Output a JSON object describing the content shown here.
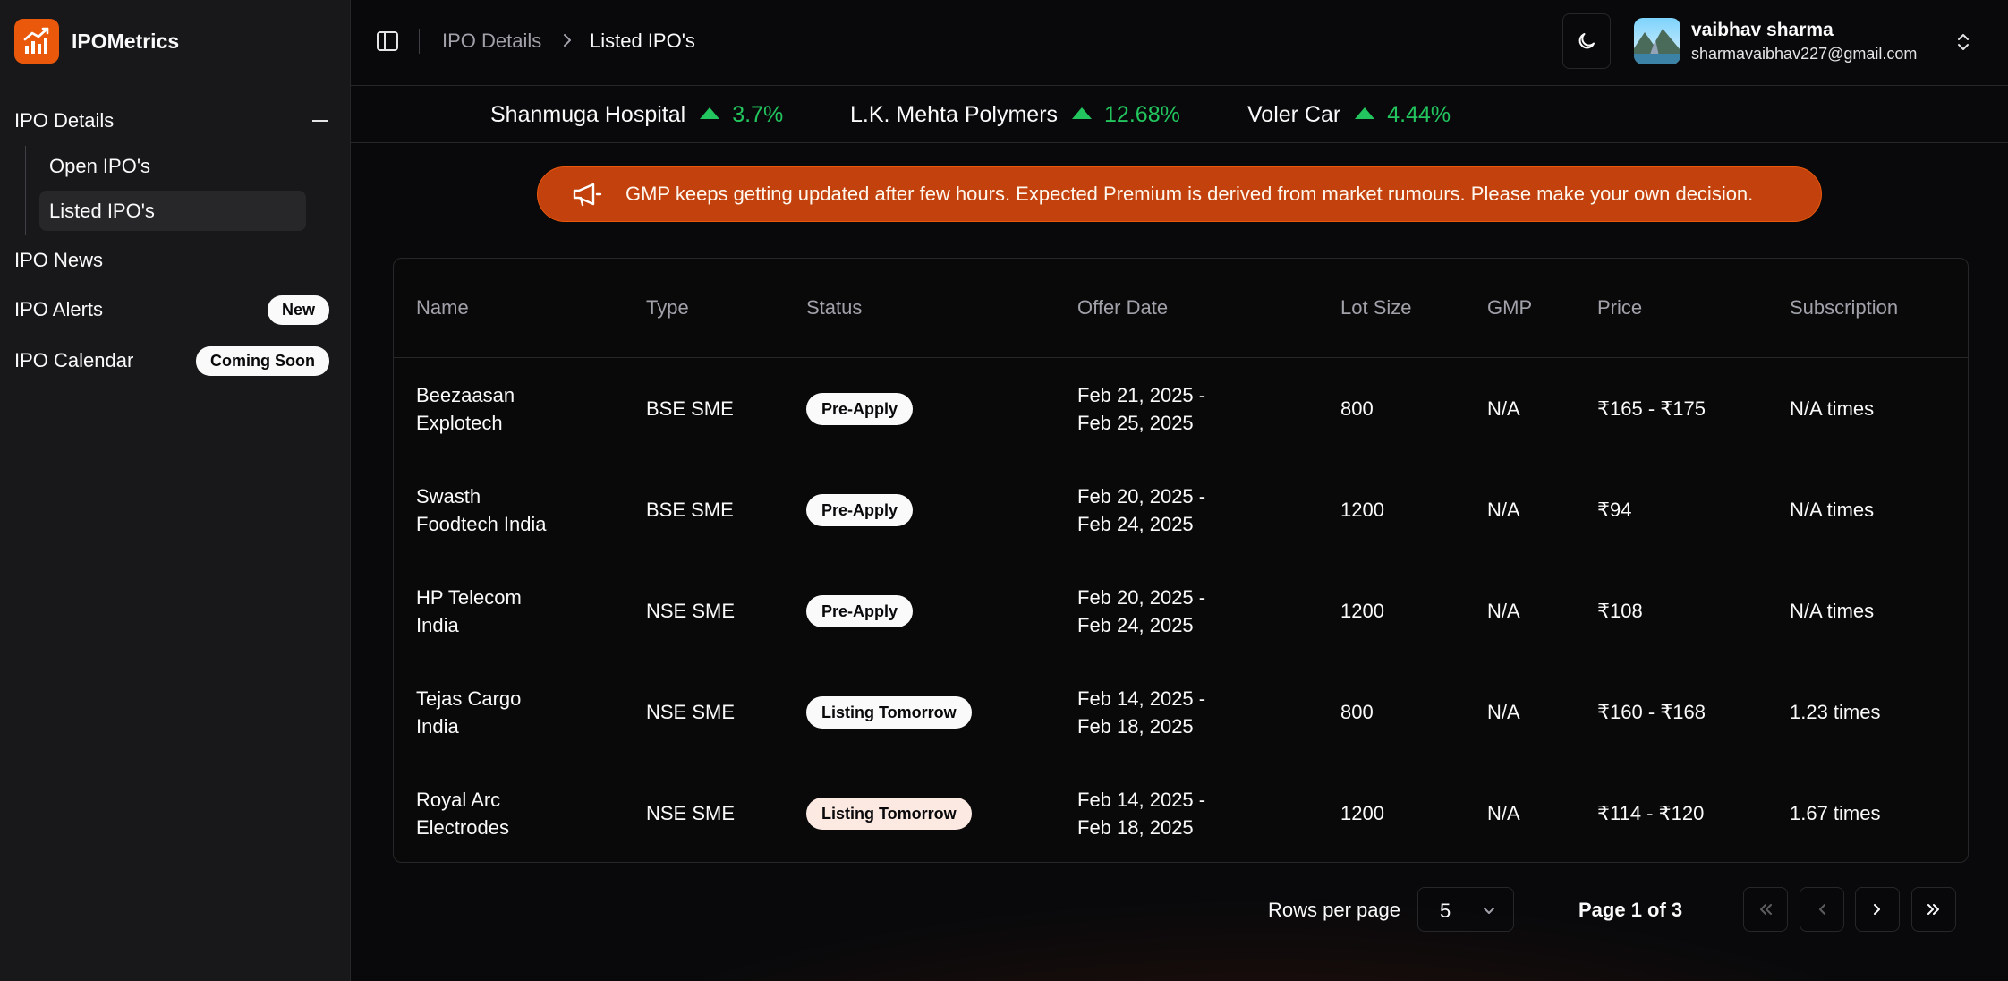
{
  "app": {
    "name": "IPOMetrics"
  },
  "sidebar": {
    "group_label": "IPO Details",
    "sub_items": [
      {
        "label": "Open IPO's"
      },
      {
        "label": "Listed IPO's"
      }
    ],
    "items": [
      {
        "label": "IPO News"
      },
      {
        "label": "IPO Alerts",
        "badge": "New"
      },
      {
        "label": "IPO Calendar",
        "badge": "Coming Soon"
      }
    ]
  },
  "header": {
    "breadcrumb": [
      "IPO Details",
      "Listed IPO's"
    ],
    "user": {
      "name": "vaibhav sharma",
      "email": "sharmavaibhav227@gmail.com"
    }
  },
  "ticker": [
    {
      "name": "Shanmuga Hospital",
      "change": "3.7%"
    },
    {
      "name": "L.K. Mehta Polymers",
      "change": "12.68%"
    },
    {
      "name": "Voler Car",
      "change": "4.44%"
    }
  ],
  "notice": {
    "text": "GMP keeps getting updated after few hours. Expected Premium is derived from market rumours. Please make your own decision."
  },
  "table": {
    "columns": [
      "Name",
      "Type",
      "Status",
      "Offer Date",
      "Lot Size",
      "GMP",
      "Price",
      "Subscription"
    ],
    "rows": [
      {
        "name_line1": "Beezaasan",
        "name_line2": "Explotech",
        "type": "BSE SME",
        "status": "Pre-Apply",
        "date_line1": "Feb 21, 2025 -",
        "date_line2": "Feb 25, 2025",
        "lot": "800",
        "gmp": "N/A",
        "price": "₹165 - ₹175",
        "subscription": "N/A times"
      },
      {
        "name_line1": "Swasth",
        "name_line2": "Foodtech India",
        "type": "BSE SME",
        "status": "Pre-Apply",
        "date_line1": "Feb 20, 2025 -",
        "date_line2": "Feb 24, 2025",
        "lot": "1200",
        "gmp": "N/A",
        "price": "₹94",
        "subscription": "N/A times"
      },
      {
        "name_line1": "HP Telecom",
        "name_line2": "India",
        "type": "NSE SME",
        "status": "Pre-Apply",
        "date_line1": "Feb 20, 2025 -",
        "date_line2": "Feb 24, 2025",
        "lot": "1200",
        "gmp": "N/A",
        "price": "₹108",
        "subscription": "N/A times"
      },
      {
        "name_line1": "Tejas Cargo",
        "name_line2": "India",
        "type": "NSE SME",
        "status": "Listing Tomorrow",
        "date_line1": "Feb 14, 2025 -",
        "date_line2": "Feb 18, 2025",
        "lot": "800",
        "gmp": "N/A",
        "price": "₹160 - ₹168",
        "subscription": "1.23 times"
      },
      {
        "name_line1": "Royal Arc",
        "name_line2": "Electrodes",
        "type": "NSE SME",
        "status": "Listing Tomorrow",
        "date_line1": "Feb 14, 2025 -",
        "date_line2": "Feb 18, 2025",
        "lot": "1200",
        "gmp": "N/A",
        "price": "₹114 - ₹120",
        "subscription": "1.67 times"
      }
    ]
  },
  "pagination": {
    "rows_per_page_label": "Rows per page",
    "rows_per_page_value": "5",
    "page_info": "Page 1 of 3"
  },
  "icons": {
    "brand": "chart-icon",
    "sidebar_toggle": "panel-left-icon",
    "breadcrumb_separator": "chevron-right-icon",
    "theme": "moon-icon",
    "user_menu": "chevrons-up-down-icon",
    "ticker_change": "triangle-up-icon",
    "notice": "megaphone-icon",
    "pager": [
      "chevrons-left-icon",
      "chevron-left-icon",
      "chevron-right-icon",
      "chevrons-right-icon"
    ]
  },
  "colors": {
    "accent": "#ea580c",
    "notice_bg": "#c2410c",
    "positive": "#22c55e",
    "background": "#09090b",
    "sidebar_bg": "#18181b"
  }
}
